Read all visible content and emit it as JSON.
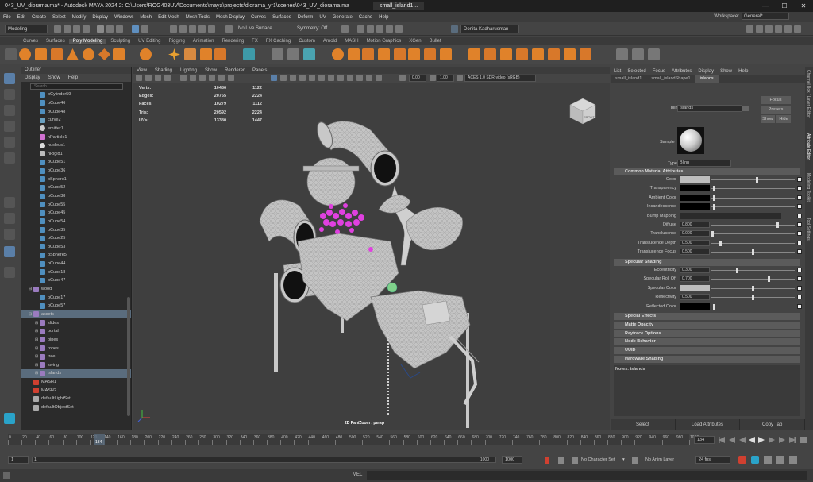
{
  "window": {
    "title": "043_UV_diorama.ma* - Autodesk MAYA 2024.2: C:\\Users\\ROG403UV\\Documents\\maya\\projects\\diorama_yr1\\scenes\\043_UV_diorama.ma",
    "tab": "small_island1...",
    "minimize": "—",
    "maximize": "☐",
    "close": "✕"
  },
  "menubar": [
    "File",
    "Edit",
    "Create",
    "Select",
    "Modify",
    "Display",
    "Windows",
    "Mesh",
    "Edit Mesh",
    "Mesh Tools",
    "Mesh Display",
    "Curves",
    "Surfaces",
    "Deform",
    "UV",
    "Generate",
    "Cache",
    "Help"
  ],
  "workspace": {
    "label": "Workspace:",
    "value": "General*"
  },
  "statusline": {
    "mode": "Modeling",
    "live_surface": "No Live Surface",
    "symmetry": "Symmetry: Off",
    "user": "Donita Kadharusman"
  },
  "shelf_tabs": [
    "Curves",
    "Surfaces",
    "Poly Modeling",
    "Sculpting",
    "UV Editing",
    "Rigging",
    "Animation",
    "Rendering",
    "FX",
    "FX Caching",
    "Custom",
    "Arnold",
    "MASH",
    "Motion Graphics",
    "XGen",
    "Bullet"
  ],
  "shelf_active": "Poly Modeling",
  "outliner": {
    "title": "Outliner",
    "menu": [
      "Display",
      "Show",
      "Help"
    ],
    "search_placeholder": "Search...",
    "items": [
      {
        "label": "pCylinder59",
        "type": "mesh",
        "indent": 1
      },
      {
        "label": "pCube46",
        "type": "mesh",
        "indent": 1
      },
      {
        "label": "pCube48",
        "type": "mesh",
        "indent": 1
      },
      {
        "label": "curve2",
        "type": "curve",
        "indent": 1
      },
      {
        "label": "emitter1",
        "type": "emitter",
        "indent": 1
      },
      {
        "label": "nParticle1",
        "type": "particle",
        "indent": 1
      },
      {
        "label": "nucleus1",
        "type": "nucleus",
        "indent": 1
      },
      {
        "label": "nRigid1",
        "type": "rigid",
        "indent": 1
      },
      {
        "label": "pCube51",
        "type": "mesh",
        "indent": 1
      },
      {
        "label": "pCube36",
        "type": "mesh",
        "indent": 1
      },
      {
        "label": "pSphere1",
        "type": "mesh",
        "indent": 1
      },
      {
        "label": "pCube52",
        "type": "mesh",
        "indent": 1
      },
      {
        "label": "pCube38",
        "type": "mesh",
        "indent": 1
      },
      {
        "label": "pCube55",
        "type": "mesh",
        "indent": 1
      },
      {
        "label": "pCube45",
        "type": "mesh",
        "indent": 1
      },
      {
        "label": "pCube54",
        "type": "mesh",
        "indent": 1
      },
      {
        "label": "pCube35",
        "type": "mesh",
        "indent": 1
      },
      {
        "label": "pCube25",
        "type": "mesh",
        "indent": 1
      },
      {
        "label": "pCube53",
        "type": "mesh",
        "indent": 1
      },
      {
        "label": "pSphere5",
        "type": "mesh",
        "indent": 1
      },
      {
        "label": "pCube44",
        "type": "mesh",
        "indent": 1
      },
      {
        "label": "pCube18",
        "type": "mesh",
        "indent": 1
      },
      {
        "label": "pCube47",
        "type": "mesh",
        "indent": 1
      },
      {
        "label": "wood",
        "type": "group",
        "indent": 0
      },
      {
        "label": "pCube17",
        "type": "mesh",
        "indent": 1
      },
      {
        "label": "pCube57",
        "type": "mesh",
        "indent": 1
      },
      {
        "label": "assets",
        "type": "group",
        "indent": 0,
        "selected": true
      },
      {
        "label": "slides",
        "type": "group",
        "indent": 1
      },
      {
        "label": "portal",
        "type": "group",
        "indent": 1
      },
      {
        "label": "pipes",
        "type": "group",
        "indent": 1
      },
      {
        "label": "ropes",
        "type": "group",
        "indent": 1
      },
      {
        "label": "tree",
        "type": "group",
        "indent": 1
      },
      {
        "label": "swing",
        "type": "group",
        "indent": 1
      },
      {
        "label": "islands",
        "type": "group",
        "indent": 1,
        "selected": true
      },
      {
        "label": "MASH1",
        "type": "mash",
        "indent": 0
      },
      {
        "label": "MASH2",
        "type": "mash",
        "indent": 0
      },
      {
        "label": "defaultLightSet",
        "type": "set",
        "indent": 0
      },
      {
        "label": "defaultObjectSet",
        "type": "set",
        "indent": 0
      }
    ]
  },
  "viewport": {
    "menu": [
      "View",
      "Shading",
      "Lighting",
      "Show",
      "Renderer",
      "Panels"
    ],
    "exposure": "0.00",
    "gamma": "1.00",
    "colorspace": "ACES 1.0 SDR-video (sRGB)",
    "hud": [
      {
        "label": "Verts:",
        "v1": "10486",
        "v2": "1122"
      },
      {
        "label": "Edges:",
        "v1": "20765",
        "v2": "2224"
      },
      {
        "label": "Faces:",
        "v1": "10279",
        "v2": "1112"
      },
      {
        "label": "Tris:",
        "v1": "20592",
        "v2": "2224"
      },
      {
        "label": "UVs:",
        "v1": "13380",
        "v2": "1447"
      }
    ],
    "camera_label": "2D Pan/Zoom : persp",
    "viewcube_label": "FRONT"
  },
  "attribute_editor": {
    "menu": [
      "List",
      "Selected",
      "Focus",
      "Attributes",
      "Display",
      "Show",
      "Help"
    ],
    "tabs": [
      "small_island1",
      "small_islandShape1",
      "islands"
    ],
    "active_tab": "islands",
    "node_label": "blinn:",
    "node_name": "islands",
    "buttons": [
      "Focus",
      "Presets",
      "Show",
      "Hide"
    ],
    "sample_label": "Sample",
    "type_label": "Type",
    "type_value": "Blinn",
    "sections": {
      "common": "Common Material Attributes",
      "specular": "Specular Shading",
      "special": "Special Effects",
      "matte": "Matte Opacity",
      "raytrace": "Raytrace Options",
      "node": "Node Behavior",
      "uuid": "UUID",
      "hardware": "Hardware Shading"
    },
    "common_attrs": [
      {
        "label": "Color",
        "kind": "color",
        "color": "#bdbdbd",
        "level": 0.55
      },
      {
        "label": "Transparency",
        "kind": "color",
        "color": "#000000",
        "level": 0.02
      },
      {
        "label": "Ambient Color",
        "kind": "color",
        "color": "#000000",
        "level": 0.02
      },
      {
        "label": "Incandescence",
        "kind": "color",
        "color": "#000000",
        "level": 0.02
      },
      {
        "label": "Bump Mapping",
        "kind": "empty"
      },
      {
        "label": "Diffuse",
        "kind": "value",
        "value": "0.800",
        "level": 0.8
      },
      {
        "label": "Translucence",
        "kind": "value",
        "value": "0.000",
        "level": 0.0
      },
      {
        "label": "Translucence Depth",
        "kind": "value",
        "value": "0.500",
        "level": 0.1
      },
      {
        "label": "Translucence Focus",
        "kind": "value",
        "value": "0.500",
        "level": 0.5
      }
    ],
    "specular_attrs": [
      {
        "label": "Eccentricity",
        "kind": "value",
        "value": "0.300",
        "level": 0.3
      },
      {
        "label": "Specular Roll Off",
        "kind": "value",
        "value": "0.700",
        "level": 0.7
      },
      {
        "label": "Specular Color",
        "kind": "color",
        "color": "#bdbdbd",
        "level": 0.5
      },
      {
        "label": "Reflectivity",
        "kind": "value",
        "value": "0.500",
        "level": 0.5
      },
      {
        "label": "Reflected Color",
        "kind": "color",
        "color": "#000000",
        "level": 0.02
      }
    ],
    "notes": "Notes: islands",
    "footer": [
      "Select",
      "Load Attributes",
      "Copy Tab"
    ]
  },
  "side_tabs": [
    "Channel Box / Layer Editor",
    "Attribute Editor",
    "Modeling Toolkit",
    "Tool Settings"
  ],
  "timeline": {
    "ticks": [
      "0",
      "20",
      "40",
      "60",
      "80",
      "100",
      "120",
      "140",
      "160",
      "180",
      "200",
      "220",
      "240",
      "260",
      "280",
      "300",
      "320",
      "340",
      "360",
      "380",
      "400",
      "420",
      "440",
      "460",
      "480",
      "500",
      "520",
      "540",
      "560",
      "580",
      "600",
      "620",
      "640",
      "660",
      "680",
      "700",
      "720",
      "740",
      "760",
      "780",
      "800",
      "820",
      "840",
      "860",
      "880",
      "900",
      "920",
      "940",
      "960",
      "980",
      "1000"
    ],
    "current_frame": "134",
    "current_frame_field": "134"
  },
  "range": {
    "start": "1",
    "start_inner": "1",
    "end_inner": "1000",
    "end": "1000",
    "character_set": "No Character Set",
    "anim_layer": "No Anim Layer",
    "fps": "24 fps"
  },
  "cmdline": {
    "lang": "MEL"
  },
  "colors": {
    "accent_blue": "#5a6c7d",
    "particles": "#e040e0",
    "mesh": "#b8b8b8"
  }
}
